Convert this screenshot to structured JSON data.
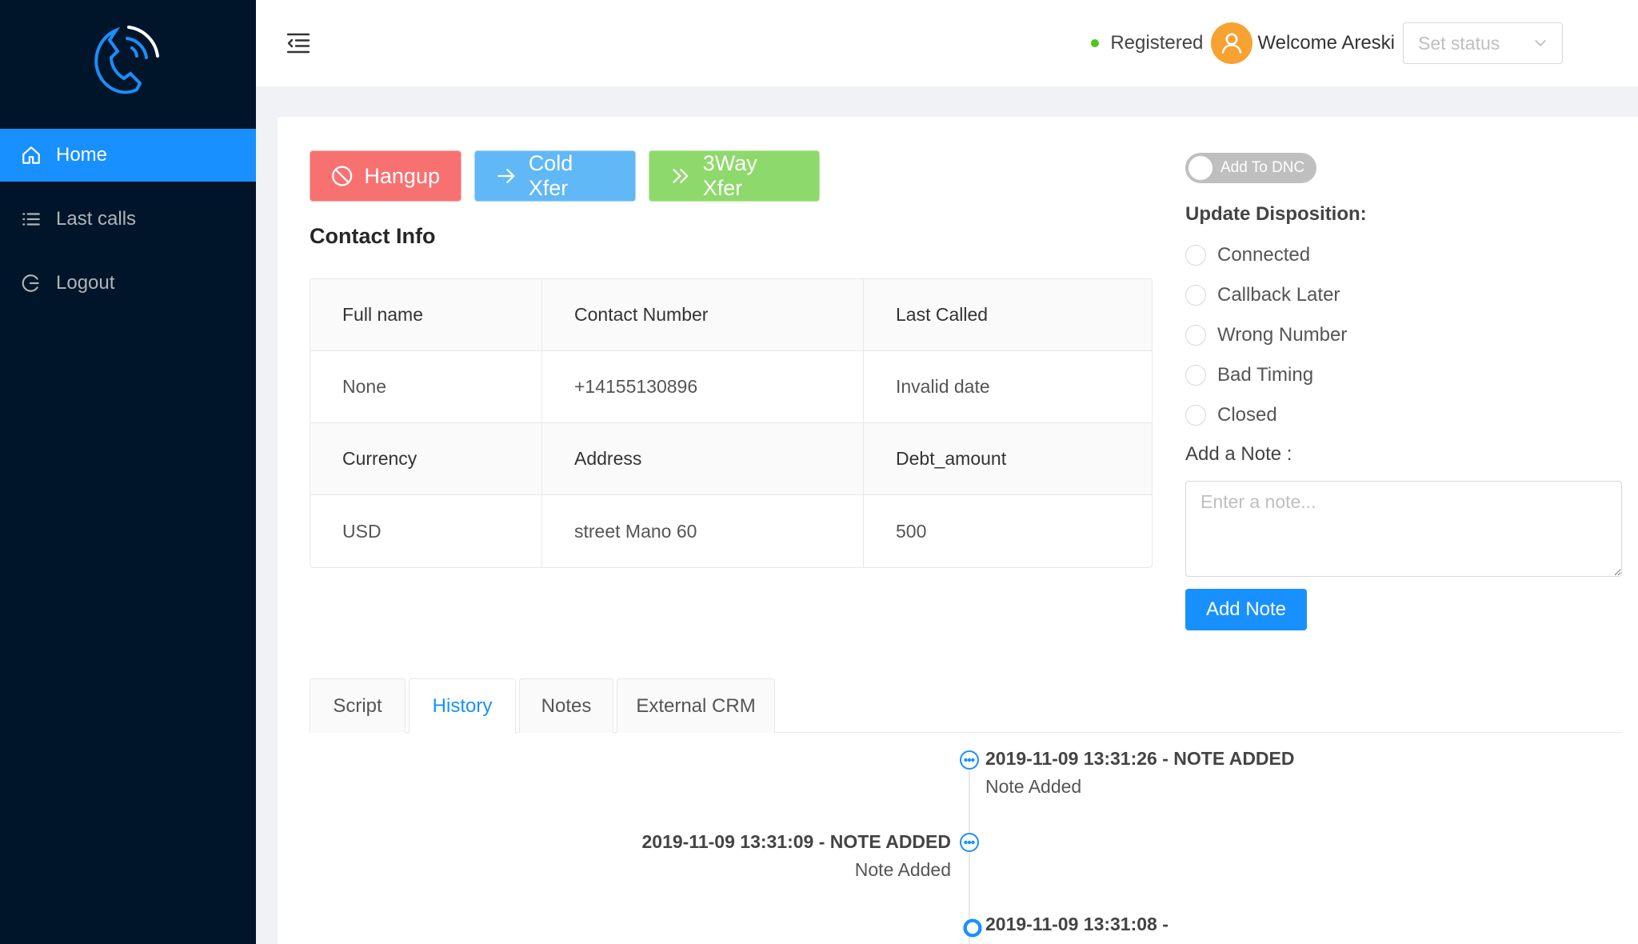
{
  "sidebar": {
    "logo_icon": "phone-call-icon",
    "items": [
      {
        "label": "Home",
        "icon": "home-icon",
        "active": true
      },
      {
        "label": "Last calls",
        "icon": "list-icon",
        "active": false
      },
      {
        "label": "Logout",
        "icon": "logout-icon",
        "active": false
      }
    ]
  },
  "header": {
    "registered_label": "Registered",
    "welcome_text": "Welcome Areski",
    "status_placeholder": "Set status"
  },
  "actions": {
    "hangup": "Hangup",
    "cold_xfer": "Cold Xfer",
    "three_way_xfer": "3Way Xfer"
  },
  "contact": {
    "title": "Contact Info",
    "rows": [
      [
        "Full name",
        "Contact Number",
        "Last Called"
      ],
      [
        "None",
        "+14155130896",
        "Invalid date"
      ],
      [
        "Currency",
        "Address",
        "Debt_amount"
      ],
      [
        "USD",
        "street Mano 60",
        "500"
      ]
    ]
  },
  "dnc": {
    "label": "Add To DNC",
    "enabled": false
  },
  "disposition": {
    "title": "Update Disposition:",
    "options": [
      "Connected",
      "Callback Later",
      "Wrong Number",
      "Bad Timing",
      "Closed"
    ]
  },
  "note": {
    "label": "Add a Note :",
    "placeholder": "Enter a note...",
    "button": "Add Note"
  },
  "tabs": [
    "Script",
    "History",
    "Notes",
    "External CRM"
  ],
  "active_tab": "History",
  "history": [
    {
      "title": "2019-11-09 13:31:26 - NOTE ADDED",
      "desc": "Note Added",
      "side": "right"
    },
    {
      "title": "2019-11-09 13:31:09 - NOTE ADDED",
      "desc": "Note Added",
      "side": "left"
    },
    {
      "title": "2019-11-09 13:31:08 -",
      "desc": "",
      "side": "right"
    }
  ],
  "colors": {
    "sidebar": "#001529",
    "primary": "#1890ff",
    "hangup": "#f87171",
    "cold_xfer": "#60b8f6",
    "three_way": "#8ed96b",
    "registered": "#52c41a",
    "avatar": "#f7a231"
  }
}
